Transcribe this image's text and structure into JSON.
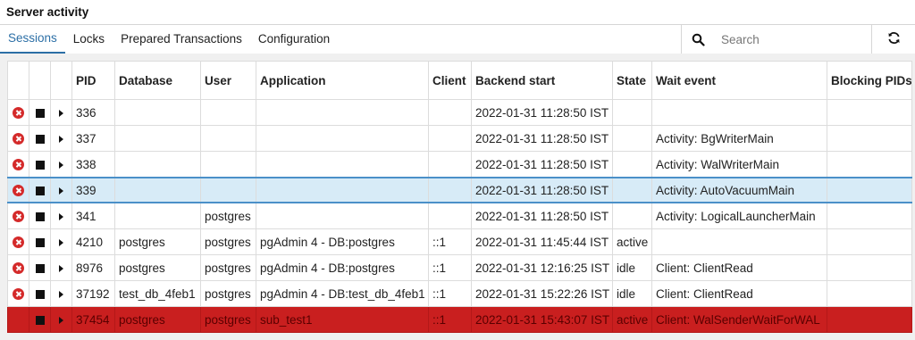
{
  "panel": {
    "title": "Server activity"
  },
  "tabs": [
    {
      "label": "Sessions"
    },
    {
      "label": "Locks"
    },
    {
      "label": "Prepared Transactions"
    },
    {
      "label": "Configuration"
    }
  ],
  "search": {
    "placeholder": "Search",
    "icon": "search-icon"
  },
  "refresh": {
    "icon": "refresh-icon"
  },
  "table": {
    "columns": [
      "PID",
      "Database",
      "User",
      "Application",
      "Client",
      "Backend start",
      "State",
      "Wait event",
      "Blocking PIDs"
    ],
    "rows": [
      {
        "pid": "336",
        "database": "",
        "user": "",
        "application": "",
        "client": "",
        "backend_start": "2022-01-31 11:28:50 IST",
        "state": "",
        "wait_event": "",
        "blocking_pids": ""
      },
      {
        "pid": "337",
        "database": "",
        "user": "",
        "application": "",
        "client": "",
        "backend_start": "2022-01-31 11:28:50 IST",
        "state": "",
        "wait_event": "Activity: BgWriterMain",
        "blocking_pids": ""
      },
      {
        "pid": "338",
        "database": "",
        "user": "",
        "application": "",
        "client": "",
        "backend_start": "2022-01-31 11:28:50 IST",
        "state": "",
        "wait_event": "Activity: WalWriterMain",
        "blocking_pids": ""
      },
      {
        "pid": "339",
        "database": "",
        "user": "",
        "application": "",
        "client": "",
        "backend_start": "2022-01-31 11:28:50 IST",
        "state": "",
        "wait_event": "Activity: AutoVacuumMain",
        "blocking_pids": ""
      },
      {
        "pid": "341",
        "database": "",
        "user": "postgres",
        "application": "",
        "client": "",
        "backend_start": "2022-01-31 11:28:50 IST",
        "state": "",
        "wait_event": "Activity: LogicalLauncherMain",
        "blocking_pids": ""
      },
      {
        "pid": "4210",
        "database": "postgres",
        "user": "postgres",
        "application": "pgAdmin 4 - DB:postgres",
        "client": "::1",
        "backend_start": "2022-01-31 11:45:44 IST",
        "state": "active",
        "wait_event": "",
        "blocking_pids": ""
      },
      {
        "pid": "8976",
        "database": "postgres",
        "user": "postgres",
        "application": "pgAdmin 4 - DB:postgres",
        "client": "::1",
        "backend_start": "2022-01-31 12:16:25 IST",
        "state": "idle",
        "wait_event": "Client: ClientRead",
        "blocking_pids": ""
      },
      {
        "pid": "37192",
        "database": "test_db_4feb1",
        "user": "postgres",
        "application": "pgAdmin 4 - DB:test_db_4feb1",
        "client": "::1",
        "backend_start": "2022-01-31 15:22:26 IST",
        "state": "idle",
        "wait_event": "Client: ClientRead",
        "blocking_pids": ""
      },
      {
        "pid": "37454",
        "database": "postgres",
        "user": "postgres",
        "application": "sub_test1",
        "client": "::1",
        "backend_start": "2022-01-31 15:43:07 IST",
        "state": "active",
        "wait_event": "Client: WalSenderWaitForWAL",
        "blocking_pids": ""
      }
    ],
    "selected_row_pid": "339",
    "highlighted_row_pid": "37454"
  },
  "colors": {
    "accent": "#2c6fa6",
    "selected_row": "#d7ebf7",
    "highlight_row": "#c91f1f",
    "cancel_icon": "#d42a2a"
  }
}
